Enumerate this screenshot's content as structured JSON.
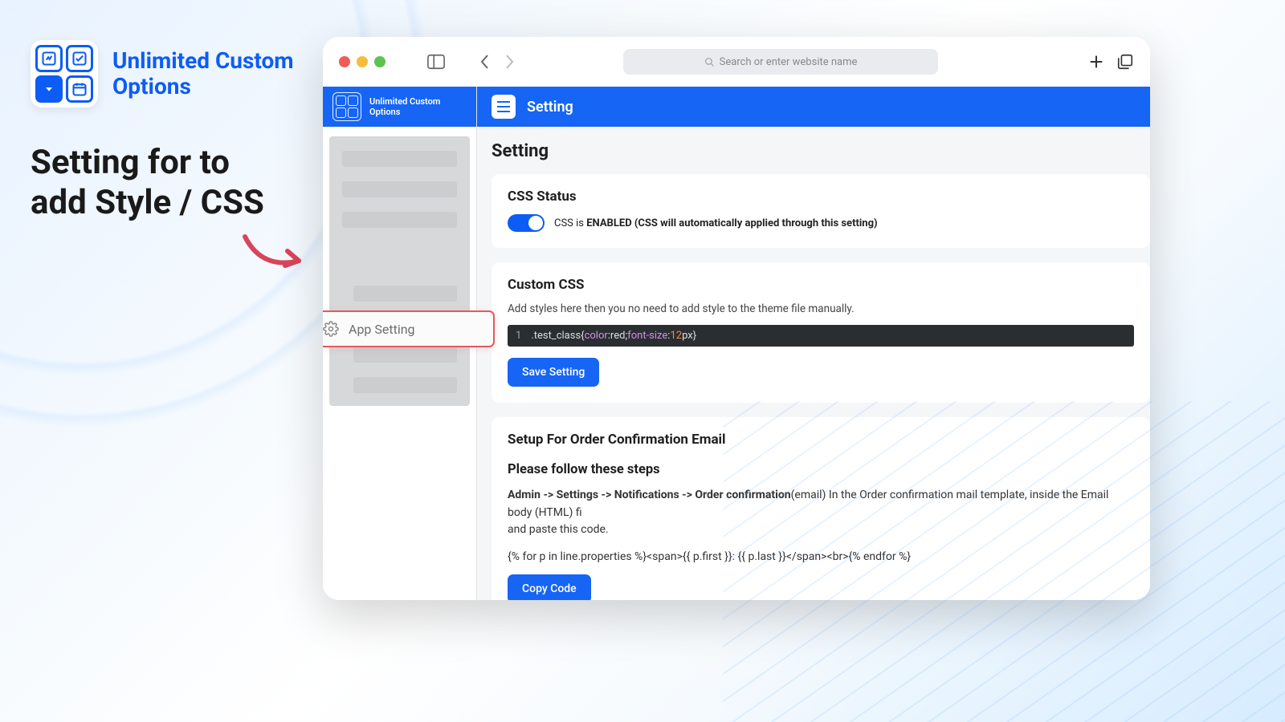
{
  "promo": {
    "title_line1": "Unlimited Custom",
    "title_line2": "Options",
    "headline_line1": "Setting for to",
    "headline_line2": "add Style / CSS"
  },
  "browser": {
    "search_placeholder": "Search or enter website name"
  },
  "sidebar": {
    "brand_line1": "Unlimited Custom",
    "brand_line2": "Options",
    "highlighted_item": "App Setting"
  },
  "header": {
    "title": "Setting"
  },
  "page": {
    "heading": "Setting",
    "css_status": {
      "title": "CSS Status",
      "prefix": "CSS is ",
      "bold": "ENABLED (CSS will automatically applied through this setting)"
    },
    "custom_css": {
      "title": "Custom CSS",
      "subtitle": "Add styles here then you no need to add style to the theme file manually.",
      "code_line_num": "1",
      "code_selector": ".test_class{",
      "code_prop1": "color",
      "code_val1": ":red;",
      "code_prop2": "font-size",
      "code_colon": ":",
      "code_num": "12",
      "code_unit": "px}",
      "save_label": "Save Setting"
    },
    "email": {
      "title": "Setup For Order Confirmation Email",
      "steps_head": "Please follow these steps",
      "breadcrumb": "Admin -> Settings -> Notifications -> Order confirmation",
      "after_breadcrumb": "(email) In the Order confirmation mail template, inside the Email body (HTML) fi",
      "line2": "and paste this code.",
      "snippet": "{% for p in line.properties %}<span>{{ p.first }}: {{ p.last }}</span><br>{% endfor %}",
      "copy_label": "Copy Code"
    }
  }
}
